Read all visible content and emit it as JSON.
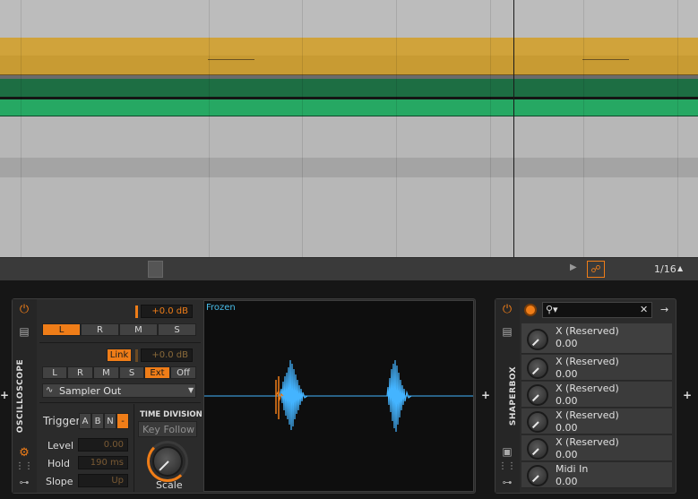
{
  "transport": {
    "grid_value": "1/16"
  },
  "oscilloscope": {
    "device_title": "OSCILLOSCOPE",
    "gain_readout": "+0.0 dB",
    "channel_buttons": [
      "L",
      "R",
      "M",
      "S"
    ],
    "link_label": "Link",
    "link_gain_readout": "+0.0 dB",
    "source_buttons": [
      "L",
      "R",
      "M",
      "S",
      "Ext",
      "Off"
    ],
    "source_select": "Sampler Out",
    "trigger_label": "Trigger",
    "trigger_buttons": [
      "A",
      "B",
      "N",
      "-"
    ],
    "level_label": "Level",
    "level_value": "0.00",
    "hold_label": "Hold",
    "hold_value": "190 ms",
    "slope_label": "Slope",
    "slope_value": "Up",
    "time_division_title": "TIME DIVISION",
    "key_follow_label": "Key Follow",
    "scale_label": "Scale",
    "display_status": "Frozen",
    "accent_color": "#ef7d18",
    "waveform_color": "#44b4ff"
  },
  "shaperbox": {
    "device_title": "SHAPERBOX",
    "params": [
      {
        "name": "X (Reserved)",
        "value": "0.00"
      },
      {
        "name": "X (Reserved)",
        "value": "0.00"
      },
      {
        "name": "X (Reserved)",
        "value": "0.00"
      },
      {
        "name": "X (Reserved)",
        "value": "0.00"
      },
      {
        "name": "X (Reserved)",
        "value": "0.00"
      },
      {
        "name": "Midi In",
        "value": "0.00"
      }
    ]
  }
}
